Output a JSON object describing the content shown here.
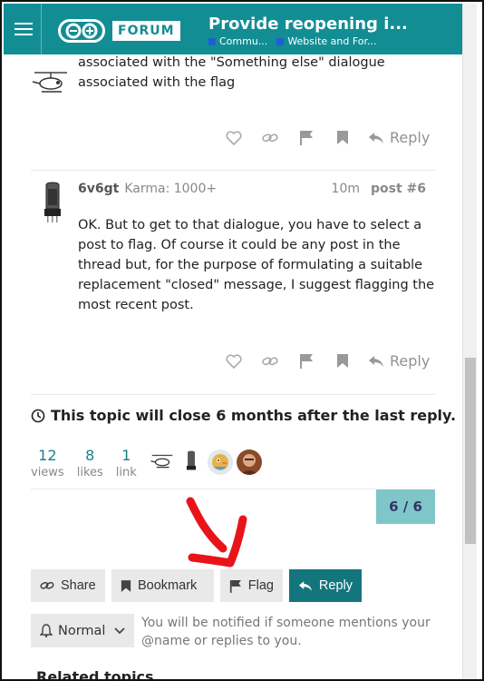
{
  "header": {
    "menu_icon": "hamburger-icon",
    "logo_text": "FORUM",
    "topic_title": "Provide reopening i...",
    "crumbs": [
      {
        "label": "Commu...",
        "color": "#1f5fd6"
      },
      {
        "label": "Website and For...",
        "color": "#1f5fd6"
      }
    ],
    "brand_color": "#138d94"
  },
  "previous_post": {
    "text_line1": "associated with the \"Something else\" dialogue",
    "text_line2": "associated with the flag",
    "reply_label": "Reply"
  },
  "post6": {
    "username": "6v6gt",
    "karma": "Karma: 1000+",
    "time": "10m",
    "post_number": "post #6",
    "body": "OK. But to get to that dialogue, you have to select a post to flag. Of course it could be any post in the thread but, for the purpose of formulating a suitable replacement \"closed\" message, I suggest flagging the most recent post.",
    "reply_label": "Reply"
  },
  "close_notice": "This topic will close 6 months after the last reply.",
  "stats": [
    {
      "value": "12",
      "label": "views"
    },
    {
      "value": "8",
      "label": "likes"
    },
    {
      "value": "1",
      "label": "link"
    }
  ],
  "progress": "6 / 6",
  "footer": {
    "share": "Share",
    "bookmark": "Bookmark",
    "flag": "Flag",
    "reply": "Reply",
    "notify_level": "Normal",
    "notify_text": "You will be notified if someone mentions your @name or replies to you."
  },
  "related_heading": "Related topics",
  "accent": "#13767d"
}
